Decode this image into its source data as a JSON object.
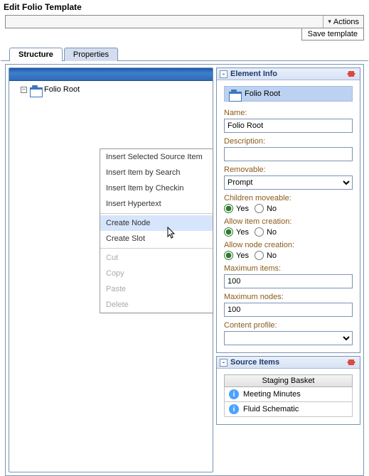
{
  "title": "Edit Folio Template",
  "actions_label": "Actions",
  "save_label": "Save template",
  "tabs": {
    "structure": "Structure",
    "properties": "Properties"
  },
  "tree": {
    "root_label": "Folio Root"
  },
  "context_menu": [
    {
      "label": "Insert Selected Source Item",
      "enabled": true
    },
    {
      "label": "Insert Item by Search",
      "enabled": true
    },
    {
      "label": "Insert Item by Checkin",
      "enabled": true
    },
    {
      "label": "Insert Hypertext",
      "enabled": true
    },
    {
      "sep": true
    },
    {
      "label": "Create Node",
      "enabled": true,
      "hover": true
    },
    {
      "label": "Create Slot",
      "enabled": true
    },
    {
      "sep": true
    },
    {
      "label": "Cut",
      "enabled": false
    },
    {
      "label": "Copy",
      "enabled": false
    },
    {
      "label": "Paste",
      "enabled": false
    },
    {
      "label": "Delete",
      "enabled": false
    }
  ],
  "element_info": {
    "panel_title": "Element Info",
    "banner": "Folio Root",
    "name_label": "Name:",
    "name_value": "Folio Root",
    "description_label": "Description:",
    "description_value": "",
    "removable_label": "Removable:",
    "removable_value": "Prompt",
    "children_moveable_label": "Children moveable:",
    "children_moveable": "Yes",
    "allow_item_label": "Allow item creation:",
    "allow_item": "Yes",
    "allow_node_label": "Allow node creation:",
    "allow_node": "Yes",
    "max_items_label": "Maximum items:",
    "max_items": "100",
    "max_nodes_label": "Maximum nodes:",
    "max_nodes": "100",
    "content_profile_label": "Content profile:",
    "content_profile": "",
    "yes": "Yes",
    "no": "No"
  },
  "source_items": {
    "panel_title": "Source Items",
    "basket_header": "Staging Basket",
    "items": [
      "Meeting Minutes",
      "Fluid Schematic"
    ]
  }
}
